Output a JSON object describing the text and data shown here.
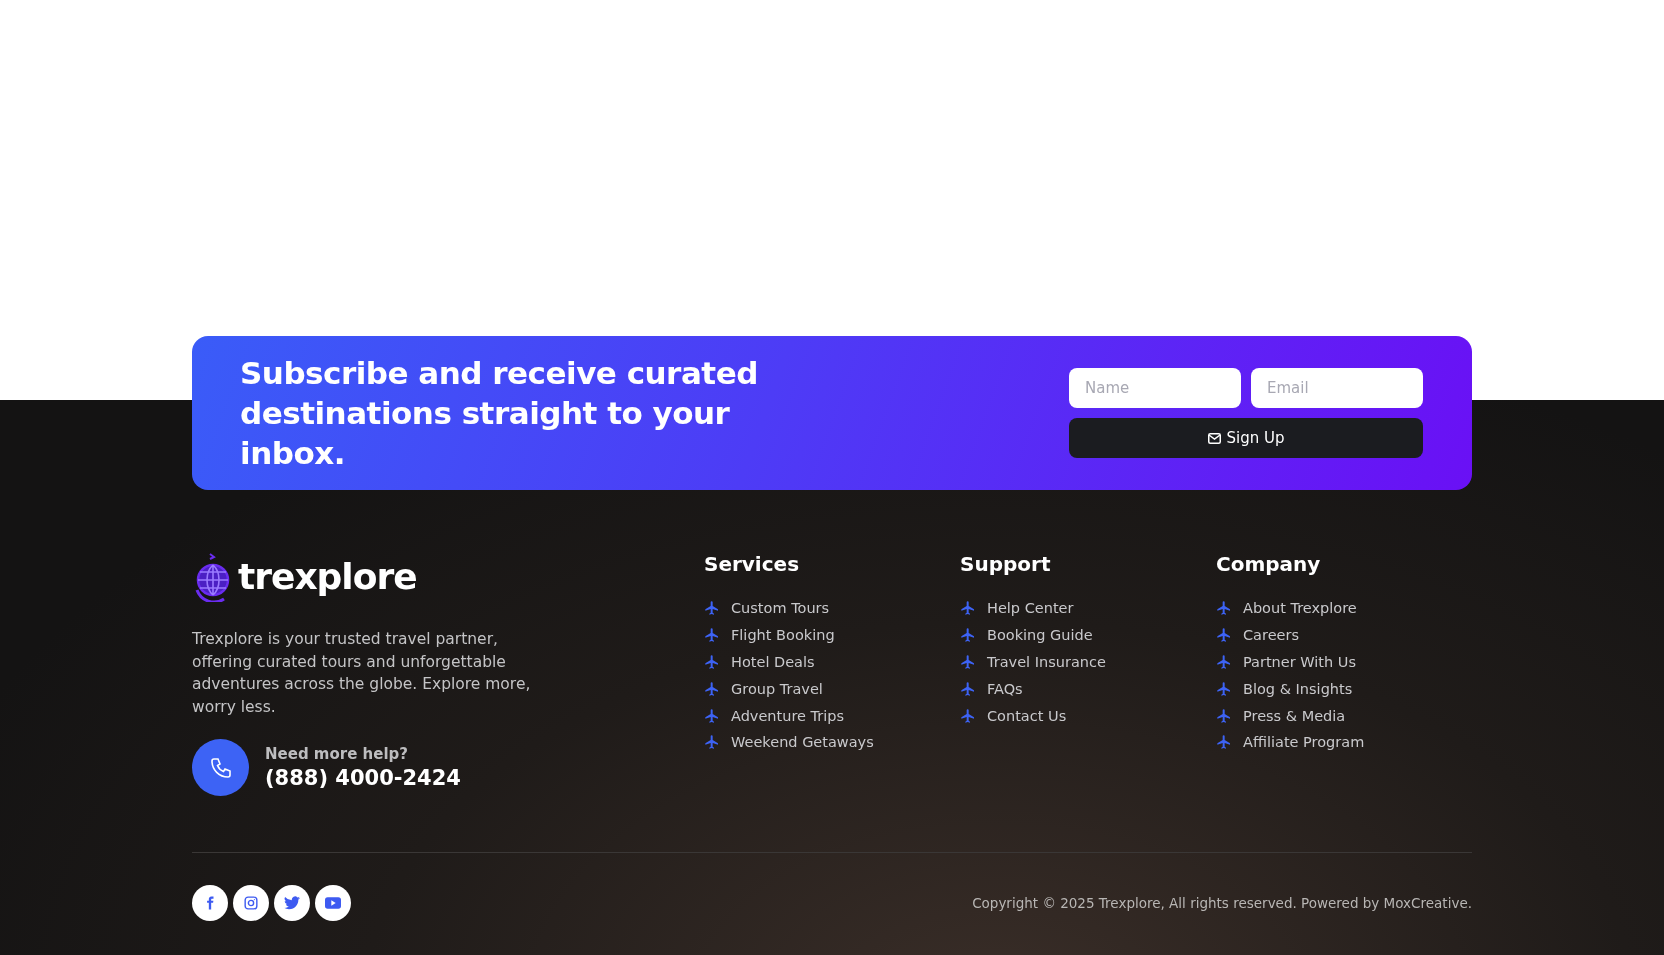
{
  "subscribe": {
    "heading": "Subscribe and receive curated destinations straight to your inbox.",
    "name_field": {
      "placeholder": "Name"
    },
    "email_field": {
      "placeholder": "Email"
    },
    "button": "Sign Up"
  },
  "brand": {
    "logo_text": "trexplore",
    "description": "Trexplore is your trusted travel partner, offering curated tours and unforgettable adventures across the globe. Explore more, worry less.",
    "help_label": "Need more help?",
    "phone": "(888) 4000-2424"
  },
  "link_columns": [
    {
      "title": "Services",
      "links": [
        "Custom Tours",
        "Flight Booking",
        "Hotel Deals",
        "Group Travel",
        "Adventure Trips",
        "Weekend Getaways"
      ]
    },
    {
      "title": "Support",
      "links": [
        "Help Center",
        "Booking Guide",
        "Travel Insurance",
        "FAQs",
        "Contact Us"
      ]
    },
    {
      "title": "Company",
      "links": [
        "About Trexplore",
        "Careers",
        "Partner With Us",
        "Blog & Insights",
        "Press & Media",
        "Affiliate Program"
      ]
    }
  ],
  "social_links": [
    {
      "kind": "facebook"
    },
    {
      "kind": "instagram"
    },
    {
      "kind": "twitter"
    },
    {
      "kind": "youtube"
    }
  ],
  "copyright": "Copyright © 2025 Trexplore, All rights reserved. Powered by MoxCreative."
}
